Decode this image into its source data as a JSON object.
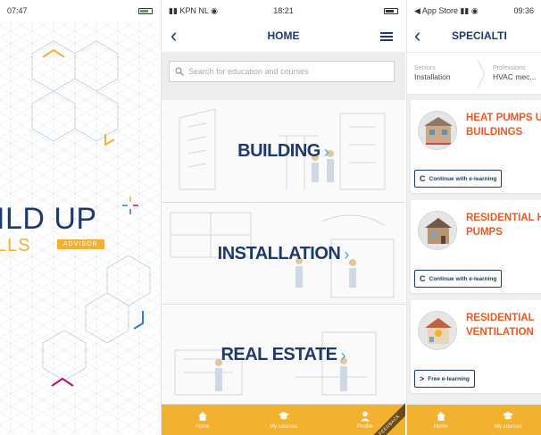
{
  "splash": {
    "status": {
      "time": "07:47"
    },
    "logo_main": "ILD UP",
    "logo_skills": "LLS",
    "advisor_badge": "ADVISOR",
    "colors": {
      "navy": "#1f3a6a",
      "yellow": "#f2b12f",
      "blue": "#2b7fd0",
      "magenta": "#b3166a"
    }
  },
  "home": {
    "status": {
      "carrier": "KPN NL",
      "time": "18:21"
    },
    "nav": {
      "title": "HOME",
      "back_icon": "chevron-left-icon",
      "menu_icon": "hamburger-menu-icon"
    },
    "search": {
      "placeholder": "Search for education and courses"
    },
    "tiles": [
      {
        "label": "BUILDING",
        "chevron": "›"
      },
      {
        "label": "INSTALLATION",
        "chevron": "›"
      },
      {
        "label": "REAL ESTATE",
        "chevron": "›"
      }
    ],
    "tabbar": {
      "items": [
        {
          "label": "Home",
          "icon": "home-icon"
        },
        {
          "label": "My courses",
          "icon": "graduation-cap-icon"
        },
        {
          "label": "Profile",
          "icon": "user-icon"
        }
      ],
      "feedback": "FEEDBACK"
    }
  },
  "specialties": {
    "status": {
      "back_app": "◀ App Store",
      "time": "09:36"
    },
    "nav": {
      "title": "SPECIALTI"
    },
    "crumbs": [
      {
        "caption": "Sectors",
        "value": "Installation"
      },
      {
        "caption": "Professions",
        "value": "HVAC mec..."
      }
    ],
    "cards": [
      {
        "title_l1": "HEAT PUMPS UT",
        "title_l2": "BUILDINGS",
        "button": "Continue with e-learning",
        "button_icon": "C"
      },
      {
        "title_l1": "RESIDENTIAL HE",
        "title_l2": "PUMPS",
        "button": "Continue with e-learning",
        "button_icon": "C"
      },
      {
        "title_l1": "RESIDENTIAL",
        "title_l2": "VENTILATION",
        "button": "Free e-learning",
        "button_icon": ">"
      }
    ],
    "tabbar": {
      "items": [
        {
          "label": "Home",
          "icon": "home-icon"
        },
        {
          "label": "My courses",
          "icon": "graduation-cap-icon"
        }
      ]
    }
  }
}
